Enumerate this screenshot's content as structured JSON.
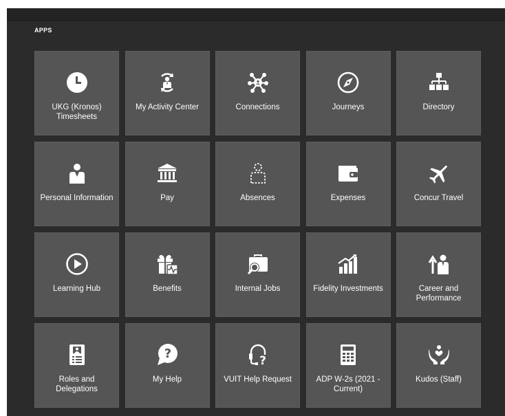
{
  "section": {
    "title": "APPS"
  },
  "tiles": [
    {
      "label": "UKG (Kronos) Timesheets",
      "icon": "clock-icon"
    },
    {
      "label": "My Activity Center",
      "icon": "activity-center-icon"
    },
    {
      "label": "Connections",
      "icon": "connections-network-icon"
    },
    {
      "label": "Journeys",
      "icon": "compass-icon"
    },
    {
      "label": "Directory",
      "icon": "org-chart-icon"
    },
    {
      "label": "Personal Information",
      "icon": "person-icon"
    },
    {
      "label": "Pay",
      "icon": "bank-icon"
    },
    {
      "label": "Absences",
      "icon": "absent-person-icon"
    },
    {
      "label": "Expenses",
      "icon": "wallet-icon"
    },
    {
      "label": "Concur Travel",
      "icon": "airplane-icon"
    },
    {
      "label": "Learning Hub",
      "icon": "play-circle-icon"
    },
    {
      "label": "Benefits",
      "icon": "gift-icon"
    },
    {
      "label": "Internal Jobs",
      "icon": "briefcase-search-icon"
    },
    {
      "label": "Fidelity Investments",
      "icon": "bar-chart-icon"
    },
    {
      "label": "Career and Performance",
      "icon": "career-growth-icon"
    },
    {
      "label": "Roles and Delegations",
      "icon": "id-badge-icon"
    },
    {
      "label": "My Help",
      "icon": "help-bubble-icon"
    },
    {
      "label": "VUIT Help Request",
      "icon": "headset-help-icon"
    },
    {
      "label": "ADP W-2s (2021 - Current)",
      "icon": "calculator-icon"
    },
    {
      "label": "Kudos (Staff)",
      "icon": "hands-heart-icon"
    }
  ]
}
